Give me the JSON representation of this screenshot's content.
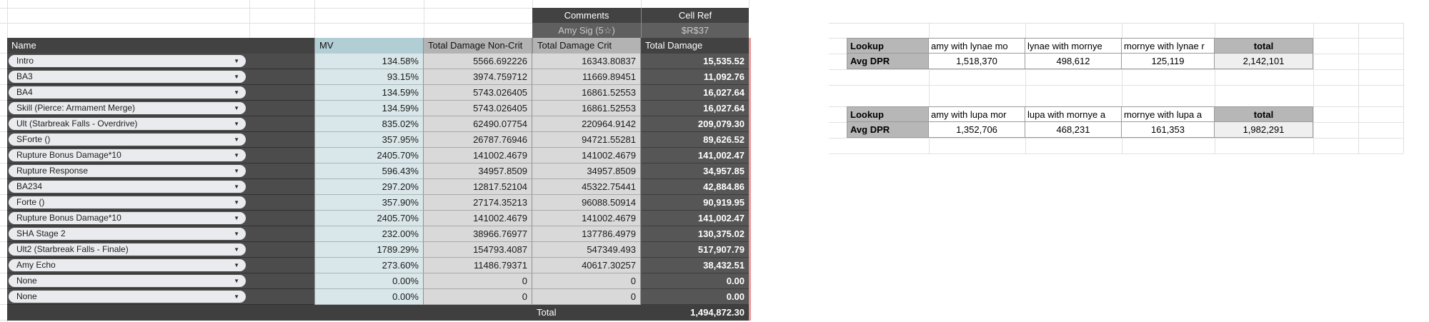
{
  "comment_block": {
    "comments_header": "Comments",
    "cellref_header": "Cell Ref",
    "comment_value": "Amy Sig (5☆)",
    "cellref_value": "$R$37"
  },
  "damage_table": {
    "columns": {
      "name": "Name",
      "mv": "MV",
      "noncrit": "Total Damage Non-Crit",
      "crit": "Total Damage Crit",
      "total": "Total Damage"
    },
    "rows": [
      {
        "name": "Intro",
        "mv": "134.58%",
        "noncrit": "5566.692226",
        "crit": "16343.80837",
        "total": "15,535.52"
      },
      {
        "name": "BA3",
        "mv": "93.15%",
        "noncrit": "3974.759712",
        "crit": "11669.89451",
        "total": "11,092.76"
      },
      {
        "name": "BA4",
        "mv": "134.59%",
        "noncrit": "5743.026405",
        "crit": "16861.52553",
        "total": "16,027.64"
      },
      {
        "name": "Skill (Pierce: Armament Merge)",
        "mv": "134.59%",
        "noncrit": "5743.026405",
        "crit": "16861.52553",
        "total": "16,027.64"
      },
      {
        "name": "Ult (Starbreak Falls - Overdrive)",
        "mv": "835.02%",
        "noncrit": "62490.07754",
        "crit": "220964.9142",
        "total": "209,079.30"
      },
      {
        "name": "SForte ()",
        "mv": "357.95%",
        "noncrit": "26787.76946",
        "crit": "94721.55281",
        "total": "89,626.52"
      },
      {
        "name": "Rupture Bonus Damage*10",
        "mv": "2405.70%",
        "noncrit": "141002.4679",
        "crit": "141002.4679",
        "total": "141,002.47"
      },
      {
        "name": "Rupture Response",
        "mv": "596.43%",
        "noncrit": "34957.8509",
        "crit": "34957.8509",
        "total": "34,957.85"
      },
      {
        "name": "BA234",
        "mv": "297.20%",
        "noncrit": "12817.52104",
        "crit": "45322.75441",
        "total": "42,884.86"
      },
      {
        "name": "Forte ()",
        "mv": "357.90%",
        "noncrit": "27174.35213",
        "crit": "96088.50914",
        "total": "90,919.95"
      },
      {
        "name": "Rupture Bonus Damage*10",
        "mv": "2405.70%",
        "noncrit": "141002.4679",
        "crit": "141002.4679",
        "total": "141,002.47"
      },
      {
        "name": "SHA Stage 2",
        "mv": "232.00%",
        "noncrit": "38966.76977",
        "crit": "137786.4979",
        "total": "130,375.02"
      },
      {
        "name": "Ult2 (Starbreak Falls - Finale)",
        "mv": "1789.29%",
        "noncrit": "154793.4087",
        "crit": "547349.493",
        "total": "517,907.79"
      },
      {
        "name": "Amy Echo",
        "mv": "273.60%",
        "noncrit": "11486.79371",
        "crit": "40617.30257",
        "total": "38,432.51"
      },
      {
        "name": "None",
        "mv": "0.00%",
        "noncrit": "0",
        "crit": "0",
        "total": "0.00"
      },
      {
        "name": "None",
        "mv": "0.00%",
        "noncrit": "0",
        "crit": "0",
        "total": "0.00"
      }
    ],
    "total_label": "Total",
    "total_value": "1,494,872.30"
  },
  "lookup_tables": [
    {
      "label": "Lookup",
      "row_label": "Avg DPR",
      "headers": [
        "amy with lynae mo",
        "lynae with mornye",
        "mornye with lynae r",
        "total"
      ],
      "values": [
        "1,518,370",
        "498,612",
        "125,119",
        "2,142,101"
      ]
    },
    {
      "label": "Lookup",
      "row_label": "Avg DPR",
      "headers": [
        "amy with lupa mor",
        "lupa with mornye a",
        "mornye with lupa a",
        "total"
      ],
      "values": [
        "1,352,706",
        "468,231",
        "161,353",
        "1,982,291"
      ]
    }
  ],
  "icons": {
    "dropdown_arrow": "▼"
  },
  "colors": {
    "dark_header": "#424242",
    "name_row": "#4c4c4c",
    "mv_header": "#b2ced5",
    "mv_cell": "#dae7ea",
    "gray_header": "#b3b3b3",
    "gray_cell": "#d9d9d9",
    "total_damage_cell": "#565656",
    "accent_pink": "#ea9999",
    "lookup_gray": "#b7b7b7"
  }
}
